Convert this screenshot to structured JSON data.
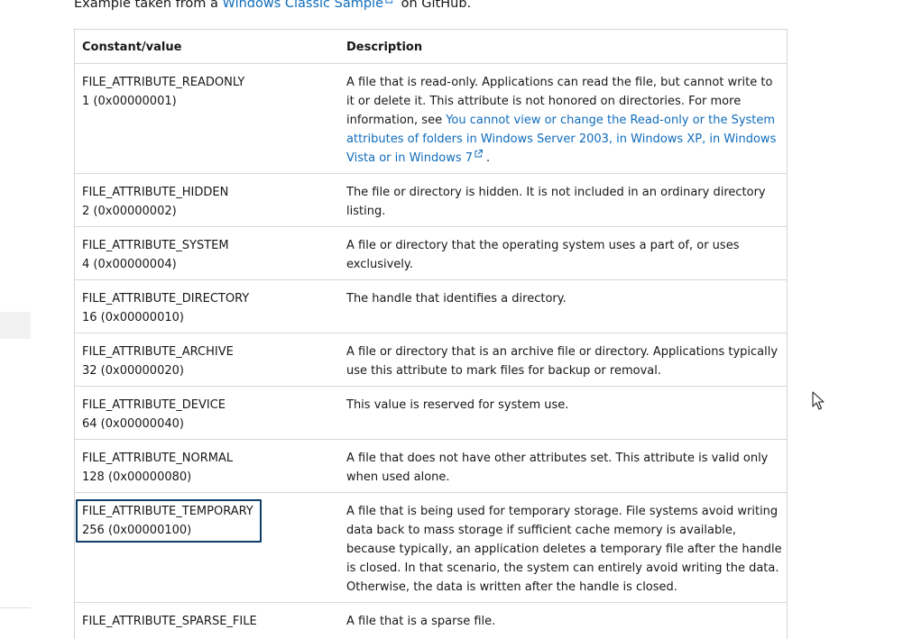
{
  "intro": {
    "prefix": "Example taken from a ",
    "link_text": "Windows Classic Sample",
    "suffix": " on GitHub."
  },
  "table": {
    "headers": {
      "constant": "Constant/value",
      "description": "Description"
    },
    "rows": [
      {
        "name": "FILE_ATTRIBUTE_READONLY",
        "value": "1 (0x00000001)",
        "description": "A file that is read-only. Applications can read the file, but cannot write to it or delete it. This attribute is not honored on directories. For more information, see ",
        "link": "You cannot view or change the Read-only or the System attributes of folders in Windows Server 2003, in Windows XP, in Windows Vista or in Windows 7",
        "after_link": "."
      },
      {
        "name": "FILE_ATTRIBUTE_HIDDEN",
        "value": "2 (0x00000002)",
        "description": "The file or directory is hidden. It is not included in an ordinary directory listing."
      },
      {
        "name": "FILE_ATTRIBUTE_SYSTEM",
        "value": "4 (0x00000004)",
        "description": "A file or directory that the operating system uses a part of, or uses exclusively."
      },
      {
        "name": "FILE_ATTRIBUTE_DIRECTORY",
        "value": "16 (0x00000010)",
        "description": "The handle that identifies a directory."
      },
      {
        "name": "FILE_ATTRIBUTE_ARCHIVE",
        "value": "32 (0x00000020)",
        "description": "A file or directory that is an archive file or directory. Applications typically use this attribute to mark files for backup or removal."
      },
      {
        "name": "FILE_ATTRIBUTE_DEVICE",
        "value": "64 (0x00000040)",
        "description": "This value is reserved for system use."
      },
      {
        "name": "FILE_ATTRIBUTE_NORMAL",
        "value": "128 (0x00000080)",
        "description": "A file that does not have other attributes set. This attribute is valid only when used alone."
      },
      {
        "name": "FILE_ATTRIBUTE_TEMPORARY",
        "value": "256 (0x00000100)",
        "description": "A file that is being used for temporary storage. File systems avoid writing data back to mass storage if sufficient cache memory is available, because typically, an application deletes a temporary file after the handle is closed. In that scenario, the system can entirely avoid writing the data. Otherwise, the data is written after the handle is closed."
      },
      {
        "name": "FILE_ATTRIBUTE_SPARSE_FILE",
        "value": "",
        "description": "A file that is a sparse file."
      }
    ]
  },
  "colors": {
    "link": "#0f6cbd",
    "focus_outline": "#0e3d6b",
    "border": "#d6d6d6"
  },
  "icons": {
    "external_link": "external-link-icon",
    "cursor": "mouse-pointer-icon"
  }
}
